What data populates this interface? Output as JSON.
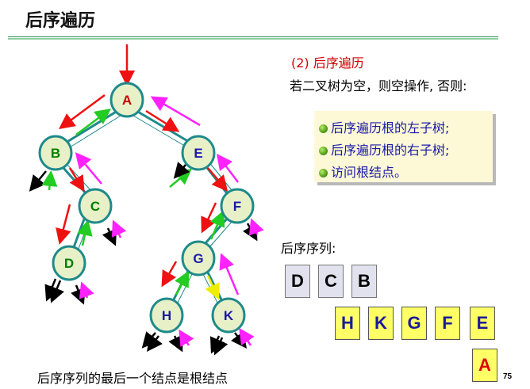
{
  "slide": {
    "title": "后序遍历",
    "heading": "(2) 后序遍历",
    "rule_text": "若二叉树为空，则空操作, 否则:",
    "steps": [
      "后序遍历根的左子树;",
      "后序遍历根的右子树;",
      "访问根结点。"
    ],
    "sequence_label": "后序序列:",
    "sequence_row1": [
      "D",
      "C",
      "B"
    ],
    "sequence_row2": [
      "H",
      "K",
      "G",
      "F",
      "E"
    ],
    "sequence_row3": [
      "A"
    ],
    "caption": "后序序列的最后一个结点是根结点",
    "page_number": "75"
  },
  "tree": {
    "nodes": [
      {
        "id": "A",
        "label": "A",
        "color": "#cc0000"
      },
      {
        "id": "B",
        "label": "B",
        "color": "#008000"
      },
      {
        "id": "E",
        "label": "E",
        "color": "#1a1aa6"
      },
      {
        "id": "C",
        "label": "C",
        "color": "#008000"
      },
      {
        "id": "F",
        "label": "F",
        "color": "#1a1aa6"
      },
      {
        "id": "D",
        "label": "D",
        "color": "#008000"
      },
      {
        "id": "G",
        "label": "G",
        "color": "#1a1aa6"
      },
      {
        "id": "H",
        "label": "H",
        "color": "#1a1aa6"
      },
      {
        "id": "K",
        "label": "K",
        "color": "#1a1aa6"
      }
    ],
    "edges": [
      [
        "A",
        "B"
      ],
      [
        "A",
        "E"
      ],
      [
        "B",
        "C"
      ],
      [
        "C",
        "D"
      ],
      [
        "E",
        "F"
      ],
      [
        "F",
        "G"
      ],
      [
        "G",
        "H"
      ],
      [
        "G",
        "K"
      ]
    ],
    "colors": {
      "node_fill": "#e8f0c8",
      "node_stroke": "#1f8a8a",
      "edge": "#1f8a8a",
      "arrow_red": "#ee1111",
      "arrow_green": "#22cc22",
      "arrow_magenta": "#ff22ff",
      "arrow_black": "#000000",
      "arrow_yellow": "#eeee00"
    }
  }
}
